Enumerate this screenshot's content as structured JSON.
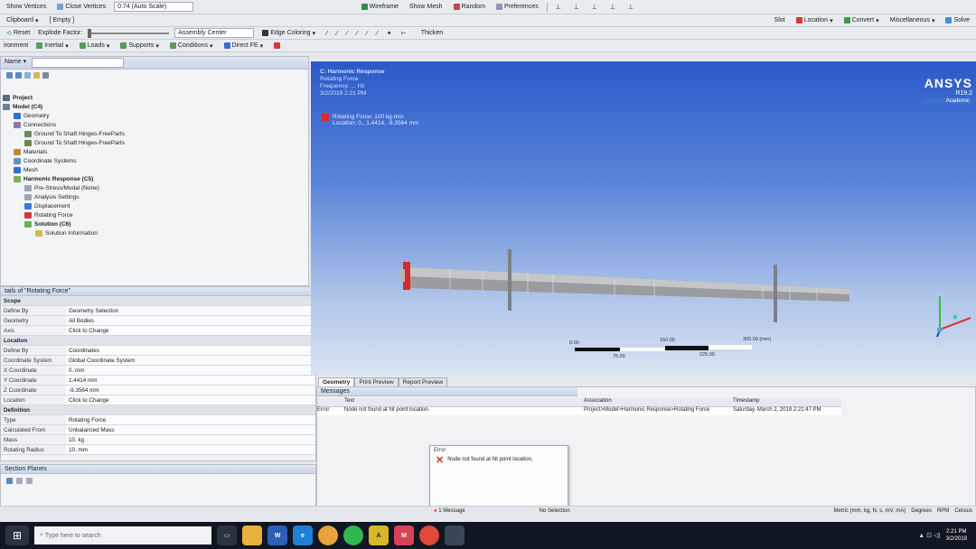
{
  "toolbar1": {
    "show_vertices": "Show Vertices",
    "close_vertices": "Close Vertices",
    "scale": "0.74 (Auto Scale)",
    "wireframe": "Wireframe",
    "show_mesh": "Show Mesh",
    "random": "Random",
    "preferences": "Preferences"
  },
  "toolbar2": {
    "clipboard": "Clipboard",
    "empty": "[ Empty ]"
  },
  "toolbar3": {
    "reset": "Reset",
    "explode_factor": "Explode Factor:",
    "assembly_center": "Assembly Center",
    "edge_coloring": "Edge Coloring",
    "thicken": "Thicken"
  },
  "toolbar4": {
    "environment": "ironment",
    "inertial": "Inertial",
    "loads": "Loads",
    "supports": "Supports",
    "conditions": "Conditions",
    "direct_fe": "Direct FE"
  },
  "right_toolbar": {
    "slot": "Slot",
    "location": "Location",
    "convert": "Convert",
    "miscellaneous": "Miscellaneous",
    "solve": "Solve"
  },
  "outline": {
    "filter_label": "Name",
    "items": [
      {
        "label": "Project",
        "depth": 0,
        "bold": true,
        "color": "#5a6b82"
      },
      {
        "label": "Model (C4)",
        "depth": 0,
        "bold": true,
        "color": "#6b7f9a"
      },
      {
        "label": "Geometry",
        "depth": 1,
        "bold": false,
        "color": "#2c6fd6"
      },
      {
        "label": "Connections",
        "depth": 1,
        "bold": false,
        "color": "#8a7aa8"
      },
      {
        "label": "Ground To Shaft Hinges-FreeParts",
        "depth": 2,
        "bold": false,
        "color": "#6c8a55"
      },
      {
        "label": "Ground To Shaft Hinges-FreeParts",
        "depth": 2,
        "bold": false,
        "color": "#6c8a55"
      },
      {
        "label": "Materials",
        "depth": 1,
        "bold": false,
        "color": "#c08a2d"
      },
      {
        "label": "Coordinate Systems",
        "depth": 1,
        "bold": false,
        "color": "#6a8fc7"
      },
      {
        "label": "Mesh",
        "depth": 1,
        "bold": false,
        "color": "#2c6fd6"
      },
      {
        "label": "Harmonic Response (C5)",
        "depth": 1,
        "bold": true,
        "color": "#7bb153"
      },
      {
        "label": "Pre-Stress/Modal (None)",
        "depth": 2,
        "bold": false,
        "color": "#9aa8b8"
      },
      {
        "label": "Analysis Settings",
        "depth": 2,
        "bold": false,
        "color": "#9aa8b8"
      },
      {
        "label": "Displacement",
        "depth": 2,
        "bold": false,
        "color": "#3b7bd8"
      },
      {
        "label": "Rotating Force",
        "depth": 2,
        "bold": false,
        "color": "#d23a3a"
      },
      {
        "label": "Solution (C6)",
        "depth": 2,
        "bold": true,
        "color": "#6cae54"
      },
      {
        "label": "Solution Information",
        "depth": 3,
        "bold": false,
        "color": "#d4b84a"
      }
    ]
  },
  "details": {
    "title": "tails of \"Rotating Force\"",
    "rows": [
      {
        "group": true,
        "label": "Scope",
        "value": ""
      },
      {
        "group": false,
        "label": "Define By",
        "value": "Geometry Selection"
      },
      {
        "group": false,
        "label": "Geometry",
        "value": "All Bodies"
      },
      {
        "group": false,
        "label": "Axis",
        "value": "Click to Change"
      },
      {
        "group": true,
        "label": "Location",
        "value": ""
      },
      {
        "group": false,
        "label": "Define By",
        "value": "Coordinates"
      },
      {
        "group": false,
        "label": "Coordinate System",
        "value": "Global Coordinate System"
      },
      {
        "group": false,
        "label": "X Coordinate",
        "value": "0. mm"
      },
      {
        "group": false,
        "label": "Y Coordinate",
        "value": "1.4414 mm"
      },
      {
        "group": false,
        "label": "Z Coordinate",
        "value": "-9.3564 mm"
      },
      {
        "group": false,
        "label": "Location",
        "value": "Click to Change"
      },
      {
        "group": true,
        "label": "Definition",
        "value": ""
      },
      {
        "group": false,
        "label": "Type",
        "value": "Rotating Force"
      },
      {
        "group": false,
        "label": "Calculated From",
        "value": "Unbalanced Mass"
      },
      {
        "group": false,
        "label": "Mass",
        "value": "10. kg"
      },
      {
        "group": false,
        "label": "Rotating Radius",
        "value": "10. mm"
      }
    ]
  },
  "section_planes": {
    "title": "Section Planes"
  },
  "viewport": {
    "overlay_title": "C: Harmonic Response",
    "overlay_lines": [
      "Rotating Force",
      "Frequency: ... Hz",
      "3/2/2019 2:21 PM"
    ],
    "legend_label": "Rotating Force: 100 kg·mm",
    "legend_sub": "Location: 0., 1.4414, -9.3564 mm",
    "ansys_brand": "ANSYS",
    "ansys_version": "R19.2",
    "ansys_edition": "Academic",
    "scale_labels": [
      "0.00",
      "150.00",
      "300.00 (mm)"
    ],
    "scale_sub": [
      "75.00",
      "225.00"
    ]
  },
  "viewport_tabs": [
    "Geometry",
    "Print Preview",
    "Report Preview"
  ],
  "messages": {
    "title": "Messages",
    "columns": [
      "Text",
      "Association",
      "Timestamp"
    ],
    "rows": [
      {
        "type": "Error",
        "text": "Node not found at hit point location.",
        "association": "Project>Model>Harmonic Response>Rotating Force",
        "timestamp": "Saturday, March 2, 2019 2:21:47 PM"
      }
    ]
  },
  "error_dialog": {
    "title": "Error",
    "text": "Node not found at hit point location."
  },
  "statusbar": {
    "messages": "1 Message",
    "selection": "No Selection",
    "units": "Metric (mm, kg, N, s, mV, mA)",
    "degrees": "Degrees",
    "rpm": "RPM",
    "celsius": "Celsius"
  },
  "taskbar": {
    "search_placeholder": "Type here to search",
    "time": "2:21 PM",
    "date": "3/2/2019"
  },
  "colors": {
    "viewport_top": "#2b59c9",
    "viewport_bottom": "#d9e3f3",
    "error": "#d62b2b",
    "taskbar": "#101722"
  }
}
